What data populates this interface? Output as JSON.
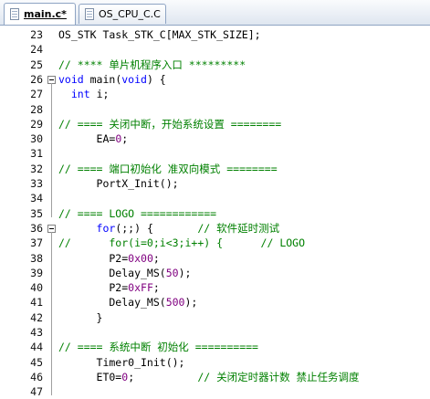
{
  "tabs": [
    {
      "label": "main.c*",
      "active": true
    },
    {
      "label": "OS_CPU_C.C",
      "active": false
    }
  ],
  "colors": {
    "keyword": "#0000ff",
    "comment": "#008000",
    "number": "#800080",
    "text": "#000000"
  },
  "lines": [
    {
      "n": "23",
      "fold": false,
      "seg": [
        {
          "t": "OS_STK Task_STK_C[MAX_STK_SIZE];",
          "c": "tx"
        }
      ]
    },
    {
      "n": "24",
      "fold": false,
      "seg": []
    },
    {
      "n": "25",
      "fold": false,
      "seg": [
        {
          "t": "// **** 单片机程序入口 *********",
          "c": "cm"
        }
      ]
    },
    {
      "n": "26",
      "fold": true,
      "seg": [
        {
          "t": "void",
          "c": "kw"
        },
        {
          "t": " main(",
          "c": "tx"
        },
        {
          "t": "void",
          "c": "kw"
        },
        {
          "t": ") {",
          "c": "tx"
        }
      ]
    },
    {
      "n": "27",
      "fold": false,
      "seg": [
        {
          "t": "  ",
          "c": "tx"
        },
        {
          "t": "int",
          "c": "kw"
        },
        {
          "t": " i;",
          "c": "tx"
        }
      ]
    },
    {
      "n": "28",
      "fold": false,
      "seg": []
    },
    {
      "n": "29",
      "fold": false,
      "seg": [
        {
          "t": "// ==== 关闭中断，开始系统设置 ========",
          "c": "cm"
        }
      ]
    },
    {
      "n": "30",
      "fold": false,
      "seg": [
        {
          "t": "      EA=",
          "c": "tx"
        },
        {
          "t": "0",
          "c": "num"
        },
        {
          "t": ";",
          "c": "tx"
        }
      ]
    },
    {
      "n": "31",
      "fold": false,
      "seg": []
    },
    {
      "n": "32",
      "fold": false,
      "seg": [
        {
          "t": "// ==== 端口初始化 准双向模式 ========",
          "c": "cm"
        }
      ]
    },
    {
      "n": "33",
      "fold": false,
      "seg": [
        {
          "t": "      PortX_Init();",
          "c": "tx"
        }
      ]
    },
    {
      "n": "34",
      "fold": false,
      "seg": []
    },
    {
      "n": "35",
      "fold": false,
      "seg": [
        {
          "t": "// ==== LOGO ============",
          "c": "cm"
        }
      ]
    },
    {
      "n": "36",
      "fold": true,
      "seg": [
        {
          "t": "      ",
          "c": "tx"
        },
        {
          "t": "for",
          "c": "kw"
        },
        {
          "t": "(;;) {       ",
          "c": "tx"
        },
        {
          "t": "// 软件延时测试",
          "c": "cm"
        }
      ]
    },
    {
      "n": "37",
      "fold": false,
      "seg": [
        {
          "t": "//      for(i=0;i<3;i++) {      // LOGO",
          "c": "cm"
        }
      ]
    },
    {
      "n": "38",
      "fold": false,
      "seg": [
        {
          "t": "        P2=",
          "c": "tx"
        },
        {
          "t": "0x00",
          "c": "num"
        },
        {
          "t": ";",
          "c": "tx"
        }
      ]
    },
    {
      "n": "39",
      "fold": false,
      "seg": [
        {
          "t": "        Delay_MS(",
          "c": "tx"
        },
        {
          "t": "50",
          "c": "num"
        },
        {
          "t": ");",
          "c": "tx"
        }
      ]
    },
    {
      "n": "40",
      "fold": false,
      "seg": [
        {
          "t": "        P2=",
          "c": "tx"
        },
        {
          "t": "0xFF",
          "c": "num"
        },
        {
          "t": ";",
          "c": "tx"
        }
      ]
    },
    {
      "n": "41",
      "fold": false,
      "seg": [
        {
          "t": "        Delay_MS(",
          "c": "tx"
        },
        {
          "t": "500",
          "c": "num"
        },
        {
          "t": ");",
          "c": "tx"
        }
      ]
    },
    {
      "n": "42",
      "fold": false,
      "seg": [
        {
          "t": "      }",
          "c": "tx"
        }
      ]
    },
    {
      "n": "43",
      "fold": false,
      "seg": []
    },
    {
      "n": "44",
      "fold": false,
      "seg": [
        {
          "t": "// ==== 系统中断 初始化 ==========",
          "c": "cm"
        }
      ]
    },
    {
      "n": "45",
      "fold": false,
      "seg": [
        {
          "t": "      Timer0_Init();",
          "c": "tx"
        }
      ]
    },
    {
      "n": "46",
      "fold": false,
      "seg": [
        {
          "t": "      ET0=",
          "c": "tx"
        },
        {
          "t": "0",
          "c": "num"
        },
        {
          "t": ";          ",
          "c": "tx"
        },
        {
          "t": "// 关闭定时器计数 禁止任务调度",
          "c": "cm"
        }
      ]
    },
    {
      "n": "47",
      "fold": false,
      "seg": []
    }
  ]
}
